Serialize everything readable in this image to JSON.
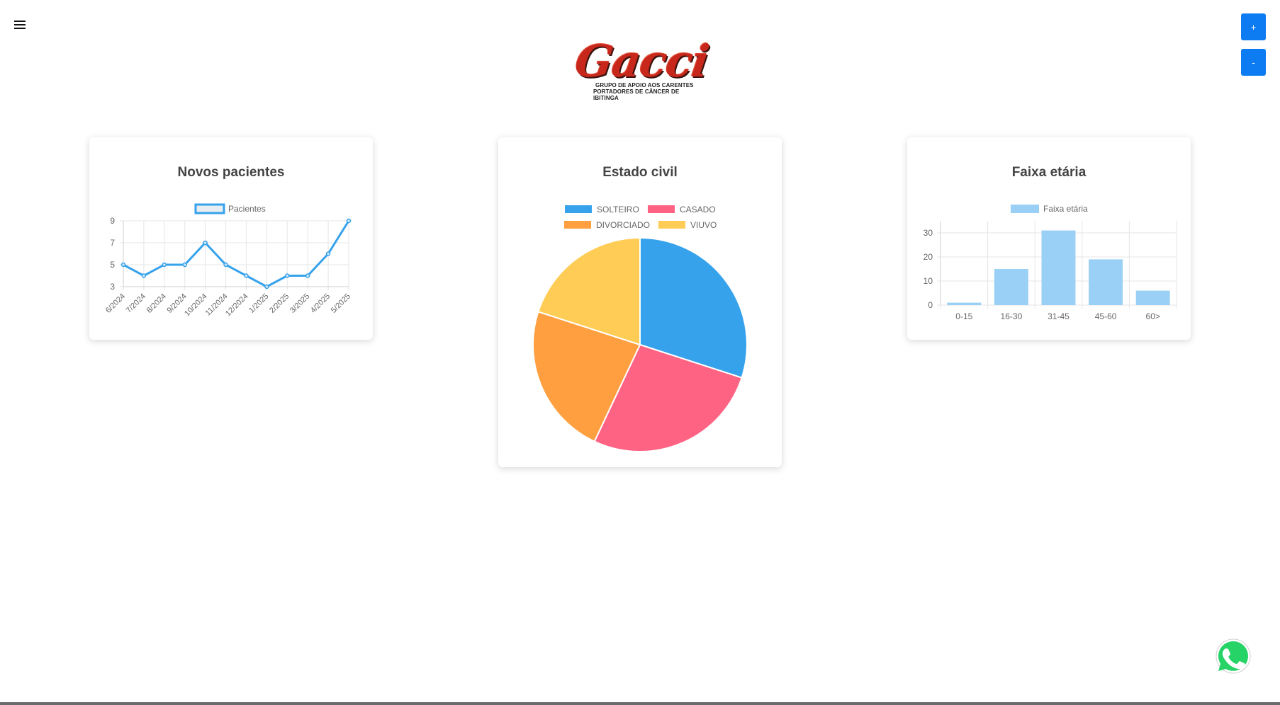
{
  "header": {
    "menu_icon": "hamburger-menu-icon",
    "zoom_in_label": "+",
    "zoom_out_label": "-"
  },
  "logo": {
    "word": "Gacci",
    "line1": "GRUPO DE APOIO AOS CARENTES",
    "line2": "PORTADORES DE CÂNCER DE IBITINGA"
  },
  "colors": {
    "accent": "#0d7cf2",
    "line": "#36a2eb",
    "solteiro": "#36a2eb",
    "casado": "#ff6384",
    "divorciado": "#ff9f40",
    "viuvo": "#ffcd56",
    "bar": "#9ad0f5"
  },
  "whatsapp_icon": "whatsapp-icon",
  "chart_data": [
    {
      "type": "line",
      "title": "Novos pacientes",
      "categories": [
        "6/2024",
        "7/2024",
        "8/2024",
        "9/2024",
        "10/2024",
        "11/2024",
        "12/2024",
        "1/2025",
        "2/2025",
        "3/2025",
        "4/2025",
        "5/2025"
      ],
      "series": [
        {
          "name": "Pacientes",
          "values": [
            5,
            4,
            5,
            5,
            7,
            5,
            4,
            3,
            4,
            4,
            6,
            9
          ]
        }
      ],
      "ylim": [
        3,
        9
      ],
      "yticks": [
        3,
        5,
        7,
        9
      ],
      "grid": true,
      "legend": "top"
    },
    {
      "type": "pie",
      "title": "Estado civil",
      "labels": [
        "SOLTEIRO",
        "CASADO",
        "DIVORCIADO",
        "VIUVO"
      ],
      "values": [
        30,
        27,
        23,
        20
      ],
      "legend": "top"
    },
    {
      "type": "bar",
      "title": "Faixa etária",
      "categories": [
        "0-15",
        "16-30",
        "31-45",
        "45-60",
        "60>"
      ],
      "series": [
        {
          "name": "Faixa etária",
          "values": [
            1,
            15,
            31,
            19,
            6
          ]
        }
      ],
      "ylim": [
        0,
        35
      ],
      "yticks": [
        0,
        10,
        20,
        30
      ],
      "grid": true,
      "legend": "top"
    }
  ]
}
